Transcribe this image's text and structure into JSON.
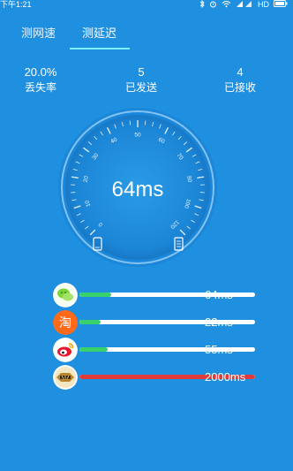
{
  "status_bar": {
    "time": "下午1:21",
    "network": "HD",
    "icons": [
      "bluetooth-icon",
      "alarm-icon",
      "wifi-icon",
      "signal-icon",
      "battery-icon"
    ]
  },
  "tabs": [
    {
      "label": "测网速",
      "active": false
    },
    {
      "label": "测延迟",
      "active": true
    }
  ],
  "stats": [
    {
      "value": "20.0%",
      "label": "丢失率"
    },
    {
      "value": "5",
      "label": "已发送"
    },
    {
      "value": "4",
      "label": "已接收"
    }
  ],
  "gauge": {
    "reading": "64ms",
    "scale_labels": [
      "0",
      "10",
      "20",
      "30",
      "40",
      "50",
      "60",
      "70",
      "80",
      "100",
      "120"
    ],
    "left_icon": "phone-icon",
    "right_icon": "server-icon"
  },
  "latency_rows": [
    {
      "app": "wechat-icon",
      "latency": "64ms",
      "fill": 0.18,
      "color": "#39d16b"
    },
    {
      "app": "taobao-icon",
      "latency": "22ms",
      "fill": 0.12,
      "color": "#39d16b"
    },
    {
      "app": "weibo-icon",
      "latency": "55ms",
      "fill": 0.16,
      "color": "#39d16b"
    },
    {
      "app": "game-icon",
      "latency": "2000ms",
      "fill": 1.0,
      "color": "#e03b3b"
    }
  ],
  "colors": {
    "background": "#1f8fe0",
    "tab_underline": "#7cf0ff",
    "ok": "#39d16b",
    "bad": "#e03b3b"
  }
}
